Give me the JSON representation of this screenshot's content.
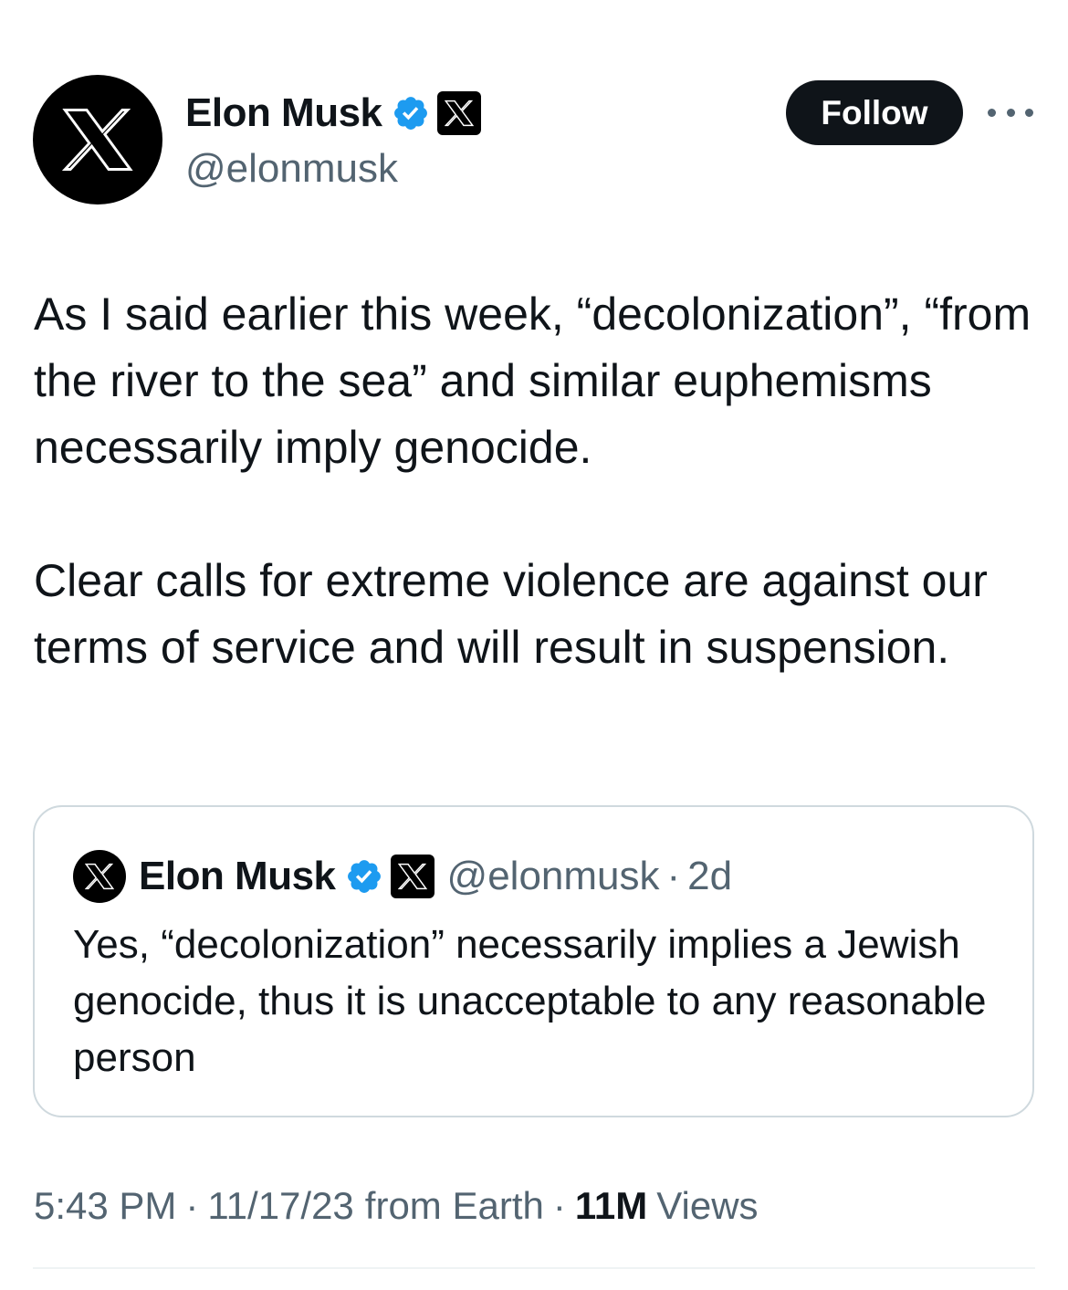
{
  "author": {
    "display_name": "Elon Musk",
    "handle": "@elonmusk",
    "avatar_icon": "x-logo-icon",
    "verified_icon": "verified-badge-icon",
    "affiliation_icon": "x-affiliate-badge-icon"
  },
  "header": {
    "follow_label": "Follow",
    "more_icon": "more-options-icon"
  },
  "tweet": {
    "paragraphs": [
      "As I said earlier this week, “decolonization”, “from the river to the sea” and similar euphemisms necessarily imply genocide.",
      "Clear calls for extreme violence are against our terms of service and will result in suspension."
    ]
  },
  "quote": {
    "display_name": "Elon Musk",
    "handle": "@elonmusk",
    "separator": "·",
    "time": "2d",
    "text": "Yes, “decolonization” necessarily implies a Jewish genocide, thus it is unacceptable to any reasonable person"
  },
  "meta": {
    "time": "5:43 PM",
    "separator": "·",
    "date": "11/17/23",
    "source": "from Earth",
    "views_count": "11M",
    "views_label": "Views"
  },
  "colors": {
    "text_primary": "#0f1419",
    "text_secondary": "#536471",
    "verified_blue": "#1d9bf0",
    "border": "#cfd9de"
  }
}
